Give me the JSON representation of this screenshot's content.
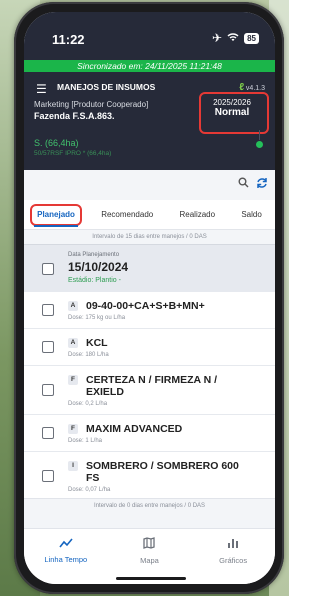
{
  "status": {
    "time": "11:22",
    "battery": "85",
    "icons": [
      "airplane-icon",
      "wifi-icon"
    ]
  },
  "sync_banner": "Sincronizado em: 24/11/2025 11:21:48",
  "header": {
    "menu_icon": "hamburger-icon",
    "title": "MANEJOS DE INSUMOS",
    "version": "v4.1.3",
    "company": "Marketing [Produtor Cooperado]",
    "farm": "Fazenda F.S.A.863.",
    "season_year": "2025/2026",
    "season_type": "Normal",
    "area": "S. (66,4ha)",
    "area_detail": "50/57RSF IPRO * (66,4ha)"
  },
  "toolbar": {
    "search_icon": "search-icon",
    "refresh_icon": "refresh-icon"
  },
  "tabs": [
    "Planejado",
    "Recomendado",
    "Realizado",
    "Saldo"
  ],
  "active_tab": "Planejado",
  "interval_top": "Intervalo de 15 dias entre manejos / 0 DAS",
  "group": {
    "label": "Data Planejamento",
    "date": "15/10/2024",
    "stage": "Estádio: Plantio -"
  },
  "items": [
    {
      "type": "A",
      "name": "09-40-00+CA+S+B+MN+",
      "dose": "Dose: 175 kg ou L/ha"
    },
    {
      "type": "A",
      "name": "KCL",
      "dose": "Dose: 180 L/ha"
    },
    {
      "type": "F",
      "name": "CERTEZA N / FIRMEZA N / EXIELD",
      "dose": "Dose: 0,2 L/ha"
    },
    {
      "type": "F",
      "name": "MAXIM ADVANCED",
      "dose": "Dose: 1 L/ha"
    },
    {
      "type": "I",
      "name": "SOMBRERO / SOMBRERO 600 FS",
      "dose": "Dose: 0,07 L/ha"
    }
  ],
  "interval_bottom": "Intervalo de 0 dias entre manejos / 0 DAS",
  "nav": [
    {
      "label": "Linha Tempo",
      "icon": "timeline-icon"
    },
    {
      "label": "Mapa",
      "icon": "map-icon"
    },
    {
      "label": "Gráficos",
      "icon": "bar-chart-icon"
    }
  ],
  "colors": {
    "accent": "#1565c0",
    "header": "#262a39",
    "sync": "#1bb54a",
    "highlight": "#e53935"
  }
}
